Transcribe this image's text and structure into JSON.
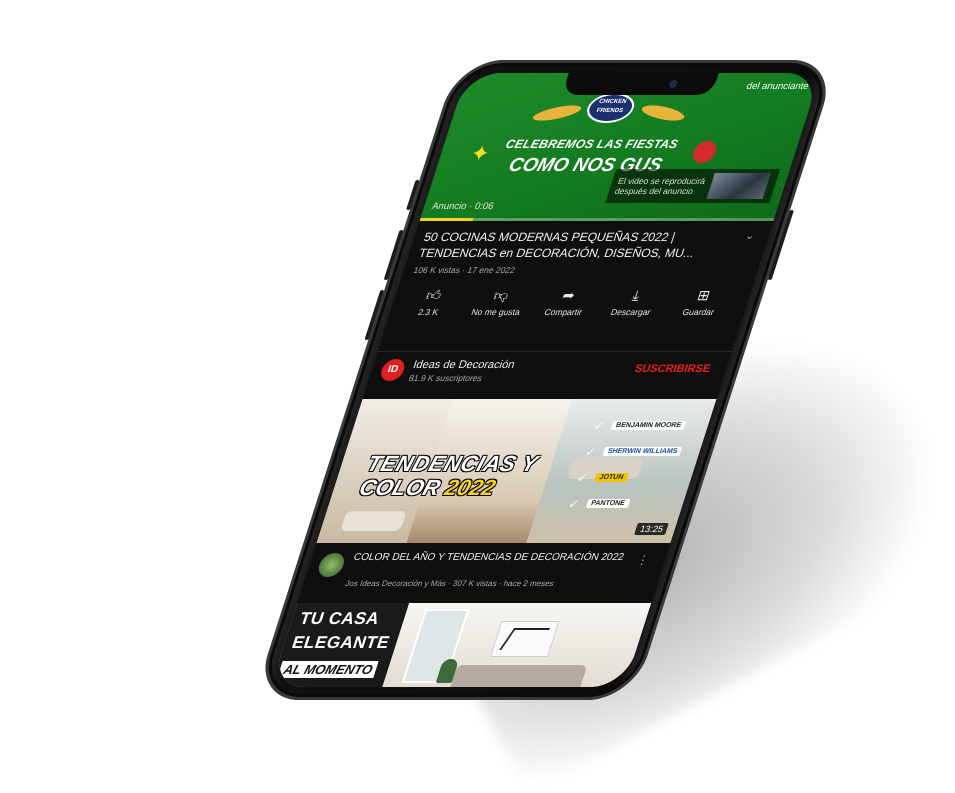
{
  "ad": {
    "top_text": "del anunciante",
    "logo_text": "CHICKEN FRIENDS",
    "headline1": "CELEBREMOS LAS FIESTAS",
    "headline2": "COMO NOS GUS",
    "next_text": "El video se reproducirá después del anuncio",
    "label": "Anuncio · 0:06",
    "progress": 0.15,
    "accent_color": "#f4d21c"
  },
  "video": {
    "title": "50 COCINAS MODERNAS PEQUEÑAS 2022 | TENDENCIAS en DECORACIÓN, DISEÑOS, MU...",
    "meta": "106 K vistas · 17 ene 2022",
    "actions": [
      {
        "icon": "thumbs-up-icon",
        "label": "2.3 K"
      },
      {
        "icon": "thumbs-down-icon",
        "label": "No me gusta"
      },
      {
        "icon": "share-icon",
        "label": "Compartir"
      },
      {
        "icon": "download-icon",
        "label": "Descargar"
      },
      {
        "icon": "save-icon",
        "label": "Guardar"
      }
    ]
  },
  "channel": {
    "avatar_text": "ID",
    "name": "Ideas de Decoración",
    "subs": "81.9 K suscriptores",
    "subscribe_label": "SUSCRIBIRSE",
    "subscribe_color": "#e62117"
  },
  "thumb1": {
    "line1": "TENDENCIAS Y",
    "line2a": "COLOR ",
    "line2b": "2022",
    "brands": [
      "BENJAMIN MOORE",
      "SHERWIN WILLIAMS",
      "JOTUN",
      "PANTONE"
    ],
    "duration": "13:25"
  },
  "video2": {
    "title": "COLOR DEL AÑO Y TENDENCIAS DE DECORACIÓN 2022",
    "meta": "Jos Ideas Decoración y Más · 307 K vistas · hace 2 meses"
  },
  "thumb2": {
    "line1": "TU CASA",
    "line2": "ELEGANTE",
    "line3": "AL MOMENTO"
  }
}
